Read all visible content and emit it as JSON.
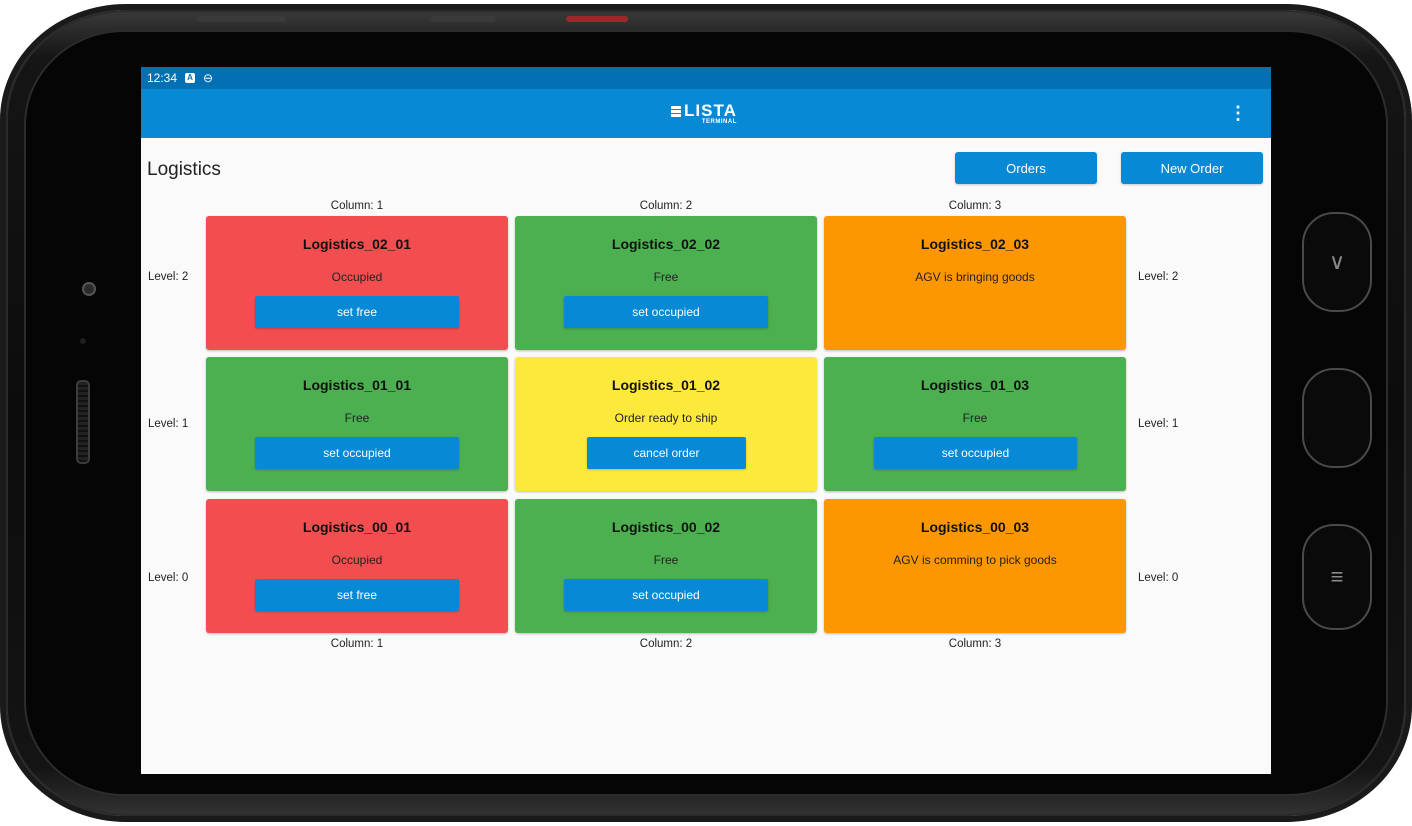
{
  "status_bar": {
    "time": "12:34"
  },
  "app_bar": {
    "logo_text": "LISTA",
    "logo_subtext": "TERMINAL",
    "menu_glyph": "⋮"
  },
  "page": {
    "title": "Logistics"
  },
  "buttons": {
    "orders": "Orders",
    "new_order": "New Order"
  },
  "columns": [
    "Column: 1",
    "Column: 2",
    "Column: 3"
  ],
  "levels": {
    "level_2": "Level: 2",
    "level_1": "Level: 1",
    "level_0": "Level: 0"
  },
  "colors": {
    "occupied": "#f34e4f",
    "free": "#4caf50",
    "agv": "#fd9701",
    "ready": "#fde93b",
    "primary": "#0789d6"
  },
  "cells": {
    "c02_01": {
      "title": "Logistics_02_01",
      "status": "Occupied",
      "action": "set free"
    },
    "c02_02": {
      "title": "Logistics_02_02",
      "status": "Free",
      "action": "set occupied"
    },
    "c02_03": {
      "title": "Logistics_02_03",
      "status": "AGV is bringing goods"
    },
    "c01_01": {
      "title": "Logistics_01_01",
      "status": "Free",
      "action": "set occupied"
    },
    "c01_02": {
      "title": "Logistics_01_02",
      "status": "Order ready to ship",
      "action": "cancel order"
    },
    "c01_03": {
      "title": "Logistics_01_03",
      "status": "Free",
      "action": "set occupied"
    },
    "c00_01": {
      "title": "Logistics_00_01",
      "status": "Occupied",
      "action": "set free"
    },
    "c00_02": {
      "title": "Logistics_00_02",
      "status": "Free",
      "action": "set occupied"
    },
    "c00_03": {
      "title": "Logistics_00_03",
      "status": "AGV is comming to pick goods"
    }
  }
}
